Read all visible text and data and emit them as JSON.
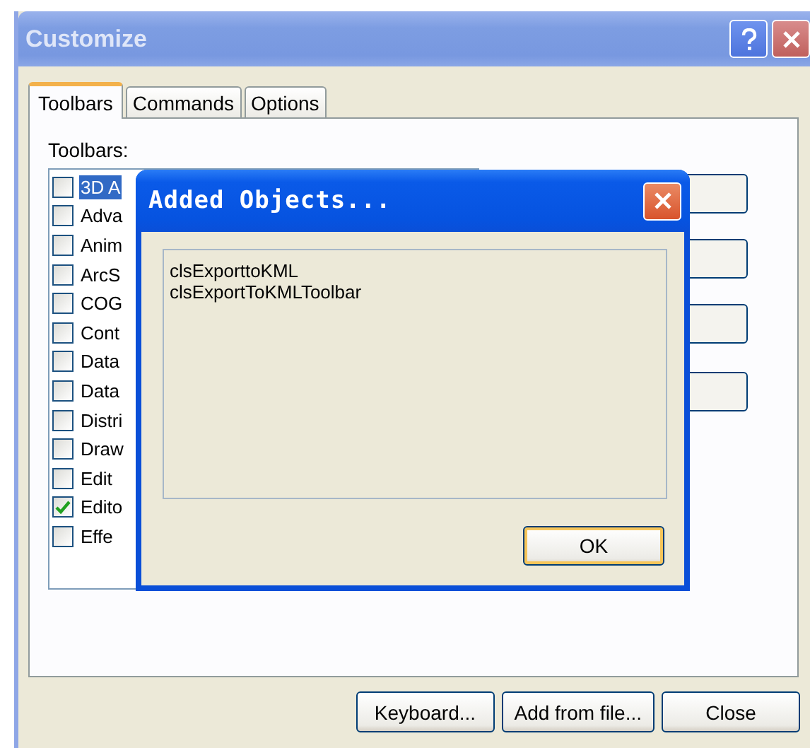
{
  "window": {
    "title": "Customize"
  },
  "tabs": [
    {
      "label": "Toolbars",
      "selected": true
    },
    {
      "label": "Commands",
      "selected": false
    },
    {
      "label": "Options",
      "selected": false
    }
  ],
  "toolbars_label": "Toolbars:",
  "toolbars": [
    {
      "label": "3D A",
      "checked": false,
      "selected": true
    },
    {
      "label": "Adva",
      "checked": false,
      "selected": false
    },
    {
      "label": "Anim",
      "checked": false,
      "selected": false
    },
    {
      "label": "ArcS",
      "checked": false,
      "selected": false
    },
    {
      "label": "COG",
      "checked": false,
      "selected": false
    },
    {
      "label": "Cont",
      "checked": false,
      "selected": false
    },
    {
      "label": "Data",
      "checked": false,
      "selected": false
    },
    {
      "label": "Data",
      "checked": false,
      "selected": false
    },
    {
      "label": "Distri",
      "checked": false,
      "selected": false
    },
    {
      "label": "Draw",
      "checked": false,
      "selected": false
    },
    {
      "label": "Edit",
      "checked": false,
      "selected": false
    },
    {
      "label": "Edito",
      "checked": true,
      "selected": false
    },
    {
      "label": "Effe",
      "checked": false,
      "selected": false
    }
  ],
  "buttons": [
    "Keyboard...",
    "Add from file...",
    "Close"
  ],
  "dialog": {
    "title": "Added Objects...",
    "items": [
      "clsExporttoKML",
      "clsExportToKMLToolbar"
    ],
    "button": "OK"
  }
}
